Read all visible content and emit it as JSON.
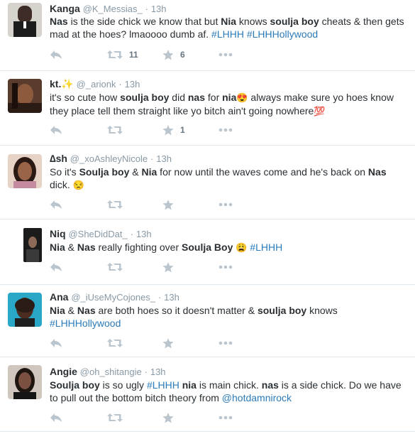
{
  "tweets": [
    {
      "name": "Kanga",
      "handle": "@K_Messias_",
      "dot": "·",
      "time": "13h",
      "parts": [
        {
          "t": "Nas",
          "b": true
        },
        {
          "t": " is the side chick we know that but "
        },
        {
          "t": "Nia",
          "b": true
        },
        {
          "t": " knows "
        },
        {
          "t": "soulja boy",
          "b": true
        },
        {
          "t": " cheats & then gets mad at the hoes? lmaoooo dumb af. "
        },
        {
          "t": "#LHHH",
          "link": true
        },
        {
          "t": " "
        },
        {
          "t": "#LHHHollywood",
          "link": true
        }
      ],
      "retweets": "11",
      "favorites": "6"
    },
    {
      "name": "kt.✨",
      "handle": "@_arionk",
      "dot": "·",
      "time": "13h",
      "parts": [
        {
          "t": "it's so cute how "
        },
        {
          "t": "soulja boy",
          "b": true
        },
        {
          "t": " did "
        },
        {
          "t": "nas",
          "b": true
        },
        {
          "t": " for "
        },
        {
          "t": "nia",
          "b": true
        },
        {
          "t": "😍",
          "emoji": true
        },
        {
          "t": " always make sure yo hoes know they place tell them straight like yo bitch ain't going nowhere"
        },
        {
          "t": "💯",
          "emoji": true
        }
      ],
      "retweets": "",
      "favorites": "1"
    },
    {
      "name": "∆sh",
      "handle": "@_xoAshleyNicole",
      "dot": "·",
      "time": "13h",
      "parts": [
        {
          "t": "So it's "
        },
        {
          "t": "Soulja boy",
          "b": true
        },
        {
          "t": " & "
        },
        {
          "t": "Nia",
          "b": true
        },
        {
          "t": " for now until the waves come and he's back on "
        },
        {
          "t": "Nas",
          "b": true
        },
        {
          "t": " dick. "
        },
        {
          "t": "😒",
          "emoji": true
        }
      ],
      "retweets": "",
      "favorites": ""
    },
    {
      "name": "Niq",
      "handle": "@SheDidDat_",
      "dot": "·",
      "time": "13h",
      "parts": [
        {
          "t": "Nia",
          "b": true
        },
        {
          "t": " & "
        },
        {
          "t": "Nas",
          "b": true
        },
        {
          "t": " really fighting over "
        },
        {
          "t": "Soulja Boy",
          "b": true
        },
        {
          "t": " "
        },
        {
          "t": "😩",
          "emoji": true
        },
        {
          "t": " "
        },
        {
          "t": "#LHHH",
          "link": true
        }
      ],
      "retweets": "",
      "favorites": ""
    },
    {
      "name": "Ana",
      "handle": "@_iUseMyCojones_",
      "dot": "·",
      "time": "13h",
      "parts": [
        {
          "t": "Nia",
          "b": true
        },
        {
          "t": " & "
        },
        {
          "t": "Nas",
          "b": true
        },
        {
          "t": " are both hoes so it doesn't matter & "
        },
        {
          "t": "soulja boy",
          "b": true
        },
        {
          "t": " knows "
        },
        {
          "t": "#LHHHollywood",
          "link": true
        }
      ],
      "retweets": "",
      "favorites": ""
    },
    {
      "name": "Angie",
      "handle": "@oh_shitangie",
      "dot": "·",
      "time": "13h",
      "parts": [
        {
          "t": "Soulja boy",
          "b": true
        },
        {
          "t": " is so ugly "
        },
        {
          "t": "#LHHH",
          "link": true
        },
        {
          "t": " "
        },
        {
          "t": "nia",
          "b": true
        },
        {
          "t": " is main chick. "
        },
        {
          "t": "nas",
          "b": true
        },
        {
          "t": " is a side chick. Do we have to pull out the bottom bitch theory from "
        },
        {
          "t": "@hotdamnirock",
          "link": true
        }
      ],
      "retweets": "",
      "favorites": ""
    }
  ],
  "colors": {
    "name": "#292f33",
    "muted": "#8899a6",
    "link": "#2b7bb9",
    "icon": "#bbc5cd",
    "count": "#66757f",
    "divider": "#e1e8ed"
  },
  "icons": {
    "reply": "reply-icon",
    "retweet": "retweet-icon",
    "favorite": "star-icon",
    "more": "more-icon"
  }
}
